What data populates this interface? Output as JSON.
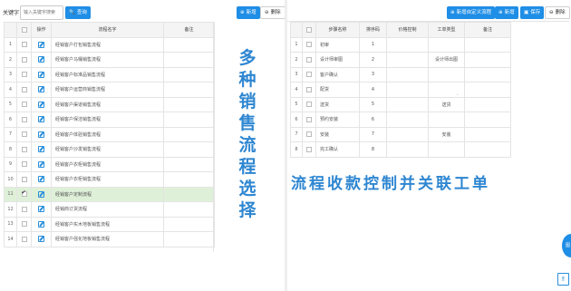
{
  "left_panel": {
    "keyword_label": "关键字",
    "search_placeholder": "输入关键字搜索",
    "search_button": "查询",
    "add_button": "新增",
    "delete_button": "删除",
    "columns": [
      "",
      "",
      "操作",
      "流程名字",
      "备注"
    ],
    "rows": [
      {
        "idx": "1",
        "name": "经销客户打包销售流程"
      },
      {
        "idx": "2",
        "name": "经销客户马桶销售流程"
      },
      {
        "idx": "3",
        "name": "经销客户标准品销售流程"
      },
      {
        "idx": "4",
        "name": "经销客户运营商销售流程"
      },
      {
        "idx": "5",
        "name": "经销客户渠道销售流程"
      },
      {
        "idx": "6",
        "name": "经销客户保洁销售流程"
      },
      {
        "idx": "7",
        "name": "经销客户体验销售流程"
      },
      {
        "idx": "8",
        "name": "经销客户沙发销售流程"
      },
      {
        "idx": "9",
        "name": "经销客户衣柜销售流程"
      },
      {
        "idx": "10",
        "name": "经销客户衣柜销售流程"
      },
      {
        "idx": "11",
        "name": "经销客户定制流程",
        "selected": true
      },
      {
        "idx": "12",
        "name": "经销商订货流程"
      },
      {
        "idx": "13",
        "name": "经销客户实木地板销售流程"
      },
      {
        "idx": "14",
        "name": "经销客户强化地板销售流程"
      }
    ],
    "annotation": "多种销售流程选择"
  },
  "right_panel": {
    "custom_flow_button": "新增自定义流程",
    "add_button": "新增",
    "save_button": "保存",
    "delete_button": "删除",
    "columns": [
      "",
      "",
      "步骤名称",
      "排序码",
      "价格控制",
      "工单类型",
      "备注"
    ],
    "rows": [
      {
        "idx": "1",
        "step": "初审",
        "order": "1",
        "price": "",
        "type": "",
        "note": ""
      },
      {
        "idx": "2",
        "step": "设计师审图",
        "order": "2",
        "price": "",
        "type": "设计师出图",
        "note": ""
      },
      {
        "idx": "3",
        "step": "客户确认",
        "order": "3",
        "price": "",
        "type": "",
        "note": ""
      },
      {
        "idx": "4",
        "step": "配货",
        "order": "4",
        "price": "",
        "type": "",
        "note": ""
      },
      {
        "idx": "5",
        "step": "送货",
        "order": "5",
        "price": "",
        "type": "送货",
        "note": ""
      },
      {
        "idx": "6",
        "step": "预约安装",
        "order": "6",
        "price": "",
        "type": "",
        "note": ""
      },
      {
        "idx": "7",
        "step": "安装",
        "order": "7",
        "price": "",
        "type": "安装",
        "note": ""
      },
      {
        "idx": "8",
        "step": "完工确认",
        "order": "8",
        "price": "",
        "type": "",
        "note": ""
      }
    ],
    "annotation": "流程收款控制并关联工单"
  },
  "float_button_label": "图",
  "colors": {
    "accent": "#1f8ee6",
    "selected_row": "#dff0d8",
    "annotation": "#2e86d1"
  }
}
